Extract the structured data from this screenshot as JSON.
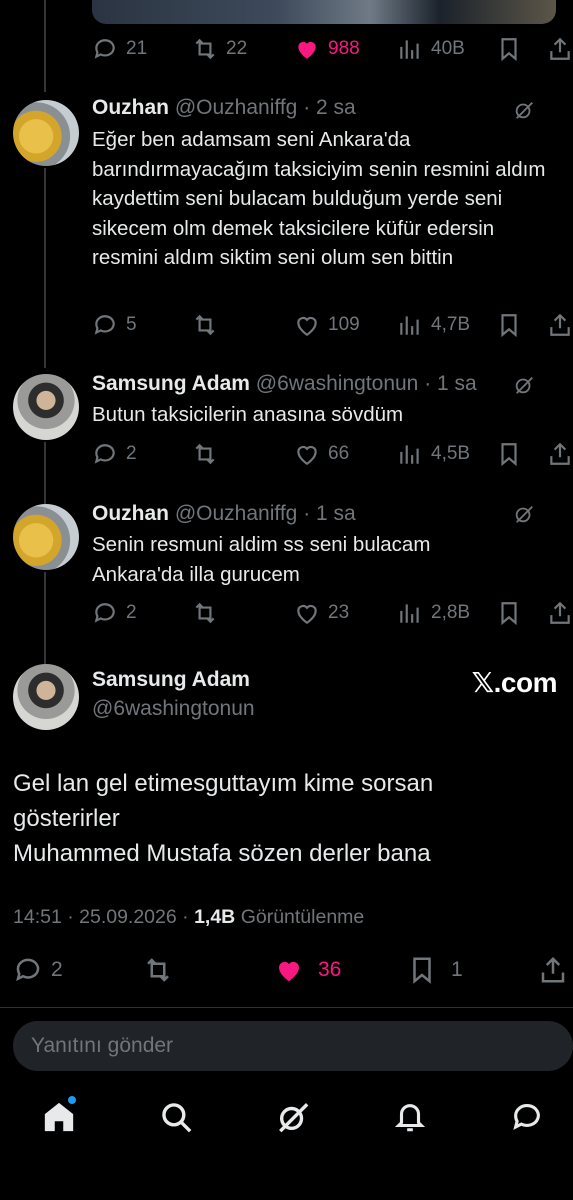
{
  "replies": [
    {
      "name": "Ouzhan",
      "handle": "@Ouzhaniffg",
      "time": "· 2 sa",
      "text": "Eğer ben adamsam seni Ankara'da barındırmayacağım taksiciyim senin resmini aldım kaydettim seni bulacam bulduğum yerde seni sikecem olm demek taksicilere küfür edersin resmini aldım siktim seni olum sen bittin",
      "replies_count": "5",
      "reposts_count": "",
      "likes_count": "109",
      "views_count": "4,7B"
    },
    {
      "name": "Samsung Adam",
      "handle": "@6washingtonun",
      "time": "· 1 sa",
      "text": "Butun taksicilerin anasına sövdüm",
      "replies_count": "2",
      "reposts_count": "",
      "likes_count": "66",
      "views_count": "4,5B"
    },
    {
      "name": "Ouzhan",
      "handle": "@Ouzhaniffg",
      "time": "· 1 sa",
      "text": "Senin resmuni aldim ss seni bulacam Ankara'da illa gurucem",
      "replies_count": "2",
      "reposts_count": "",
      "likes_count": "23",
      "views_count": "2,8B"
    }
  ],
  "top_tweet_actions": {
    "replies_count": "21",
    "reposts_count": "22",
    "likes_count": "988",
    "views_count": "40B"
  },
  "main_tweet": {
    "name": "Samsung Adam",
    "handle": "@6washingtonun",
    "brand": "𝕏.com",
    "line1": "Gel lan gel etimesguttayım kime sorsan",
    "line2": "gösterirler",
    "line3": "Muhammed Mustafa sözen derler bana",
    "time": "14:51 · 25.09.2026 ·",
    "views": "1,4B",
    "views_label": "Görüntülenme",
    "replies_count": "2",
    "likes_count": "36",
    "bookmarks_count": "1"
  },
  "reply_placeholder": "Yanıtını gönder",
  "colors": {
    "background": "#000000",
    "text": "#e7e9ea",
    "muted": "#71767b",
    "like": "#f91880",
    "accent": "#1d9bf0"
  }
}
